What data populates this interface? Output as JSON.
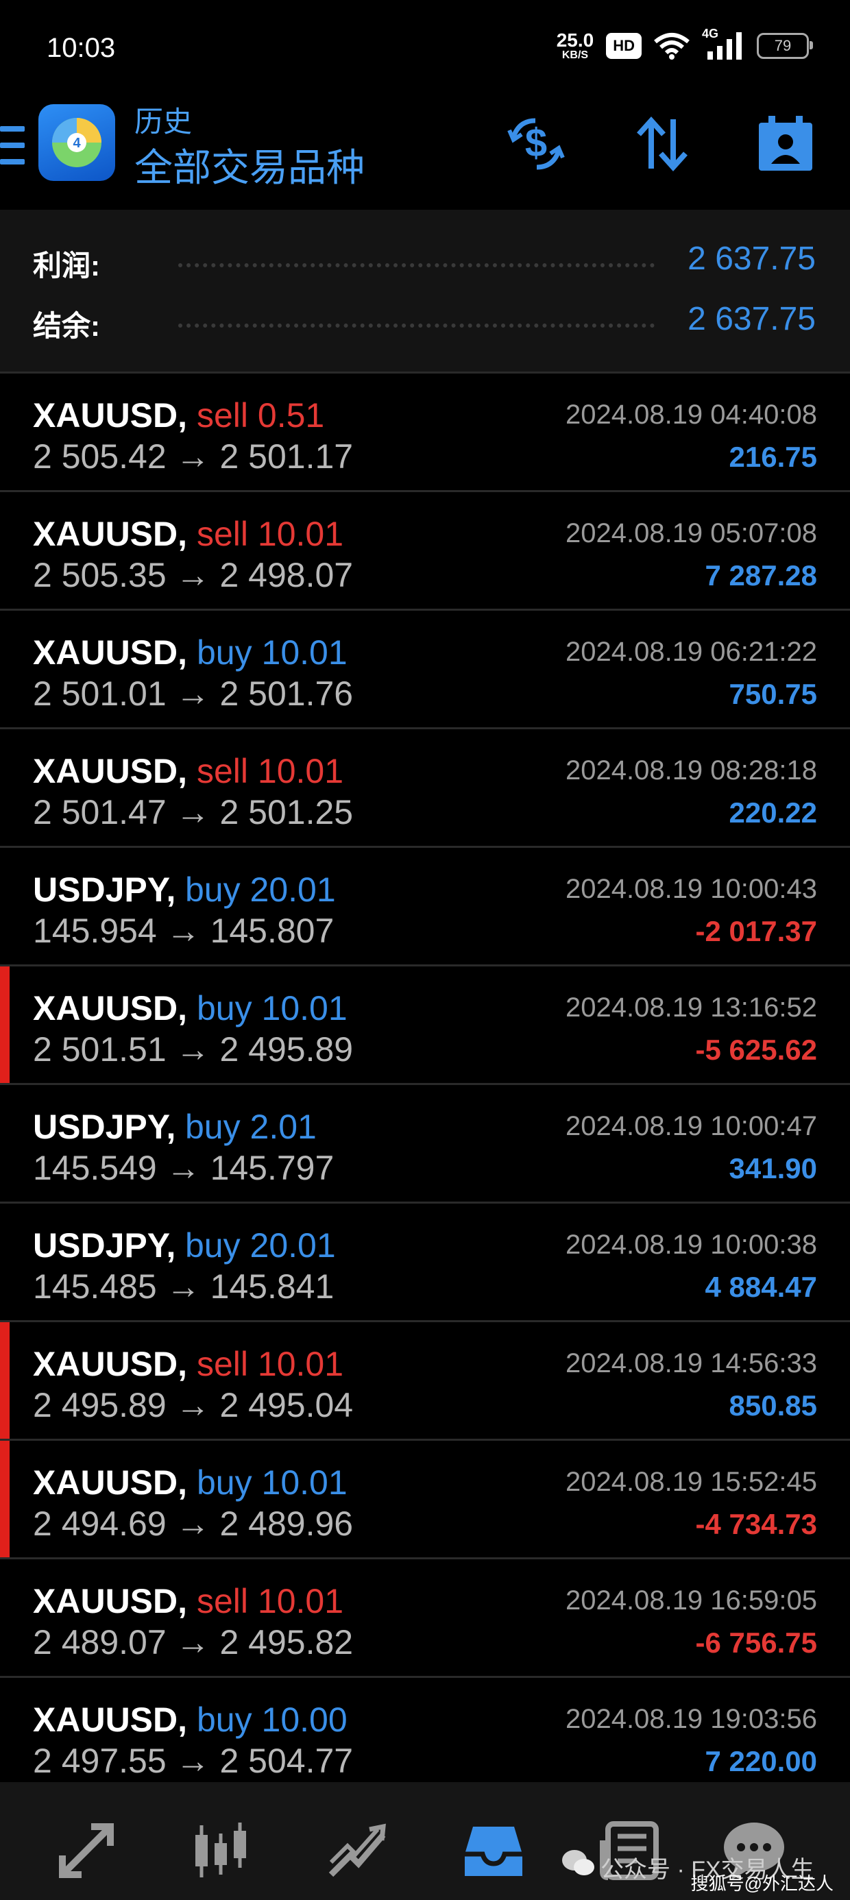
{
  "status_bar": {
    "time": "10:03",
    "net_speed_value": "25.0",
    "net_speed_unit": "KB/S",
    "hd_label": "HD",
    "signal_type": "4G",
    "battery": "79"
  },
  "header": {
    "title": "历史",
    "subtitle": "全部交易品种",
    "icons": [
      "menu-icon",
      "metatrader-logo",
      "dollar-cycle-icon",
      "sort-icon",
      "calendar-user-icon"
    ]
  },
  "summary": {
    "profit_label": "利润:",
    "profit_value": "2 637.75",
    "balance_label": "结余:",
    "balance_value": "2 637.75"
  },
  "trades": [
    {
      "symbol": "XAUUSD,",
      "side": "sell 0.51",
      "side_type": "sell",
      "open": "2 505.42",
      "close": "2 501.17",
      "time": "2024.08.19 04:40:08",
      "profit": "216.75",
      "profit_sign": "pos",
      "marked": false
    },
    {
      "symbol": "XAUUSD,",
      "side": "sell 10.01",
      "side_type": "sell",
      "open": "2 505.35",
      "close": "2 498.07",
      "time": "2024.08.19 05:07:08",
      "profit": "7 287.28",
      "profit_sign": "pos",
      "marked": false
    },
    {
      "symbol": "XAUUSD,",
      "side": "buy 10.01",
      "side_type": "buy",
      "open": "2 501.01",
      "close": "2 501.76",
      "time": "2024.08.19 06:21:22",
      "profit": "750.75",
      "profit_sign": "pos",
      "marked": false
    },
    {
      "symbol": "XAUUSD,",
      "side": "sell 10.01",
      "side_type": "sell",
      "open": "2 501.47",
      "close": "2 501.25",
      "time": "2024.08.19 08:28:18",
      "profit": "220.22",
      "profit_sign": "pos",
      "marked": false
    },
    {
      "symbol": "USDJPY,",
      "side": "buy 20.01",
      "side_type": "buy",
      "open": "145.954",
      "close": "145.807",
      "time": "2024.08.19 10:00:43",
      "profit": "-2 017.37",
      "profit_sign": "neg",
      "marked": false
    },
    {
      "symbol": "XAUUSD,",
      "side": "buy 10.01",
      "side_type": "buy",
      "open": "2 501.51",
      "close": "2 495.89",
      "time": "2024.08.19 13:16:52",
      "profit": "-5 625.62",
      "profit_sign": "neg",
      "marked": true
    },
    {
      "symbol": "USDJPY,",
      "side": "buy 2.01",
      "side_type": "buy",
      "open": "145.549",
      "close": "145.797",
      "time": "2024.08.19 10:00:47",
      "profit": "341.90",
      "profit_sign": "pos",
      "marked": false
    },
    {
      "symbol": "USDJPY,",
      "side": "buy 20.01",
      "side_type": "buy",
      "open": "145.485",
      "close": "145.841",
      "time": "2024.08.19 10:00:38",
      "profit": "4 884.47",
      "profit_sign": "pos",
      "marked": false
    },
    {
      "symbol": "XAUUSD,",
      "side": "sell 10.01",
      "side_type": "sell",
      "open": "2 495.89",
      "close": "2 495.04",
      "time": "2024.08.19 14:56:33",
      "profit": "850.85",
      "profit_sign": "pos",
      "marked": true
    },
    {
      "symbol": "XAUUSD,",
      "side": "buy 10.01",
      "side_type": "buy",
      "open": "2 494.69",
      "close": "2 489.96",
      "time": "2024.08.19 15:52:45",
      "profit": "-4 734.73",
      "profit_sign": "neg",
      "marked": true
    },
    {
      "symbol": "XAUUSD,",
      "side": "sell 10.01",
      "side_type": "sell",
      "open": "2 489.07",
      "close": "2 495.82",
      "time": "2024.08.19 16:59:05",
      "profit": "-6 756.75",
      "profit_sign": "neg",
      "marked": false
    },
    {
      "symbol": "XAUUSD,",
      "side": "buy 10.00",
      "side_type": "buy",
      "open": "2 497.55",
      "close": "2 504.77",
      "time": "2024.08.19 19:03:56",
      "profit": "7 220.00",
      "profit_sign": "pos",
      "marked": false
    }
  ],
  "arrow": "→",
  "bottom_nav": [
    {
      "name": "quotes-icon",
      "active": false
    },
    {
      "name": "chart-icon",
      "active": false
    },
    {
      "name": "trade-icon",
      "active": false
    },
    {
      "name": "history-icon",
      "active": true
    },
    {
      "name": "news-icon",
      "active": false
    },
    {
      "name": "messages-icon",
      "active": false
    }
  ],
  "watermark": {
    "wechat": "公众号 · FX交易人生",
    "sohu": "搜狐号@外汇达人"
  },
  "colors": {
    "accent_blue": "#3a8fe8",
    "sell_red": "#e53935",
    "marker_red": "#e0201b",
    "background": "#000000"
  }
}
